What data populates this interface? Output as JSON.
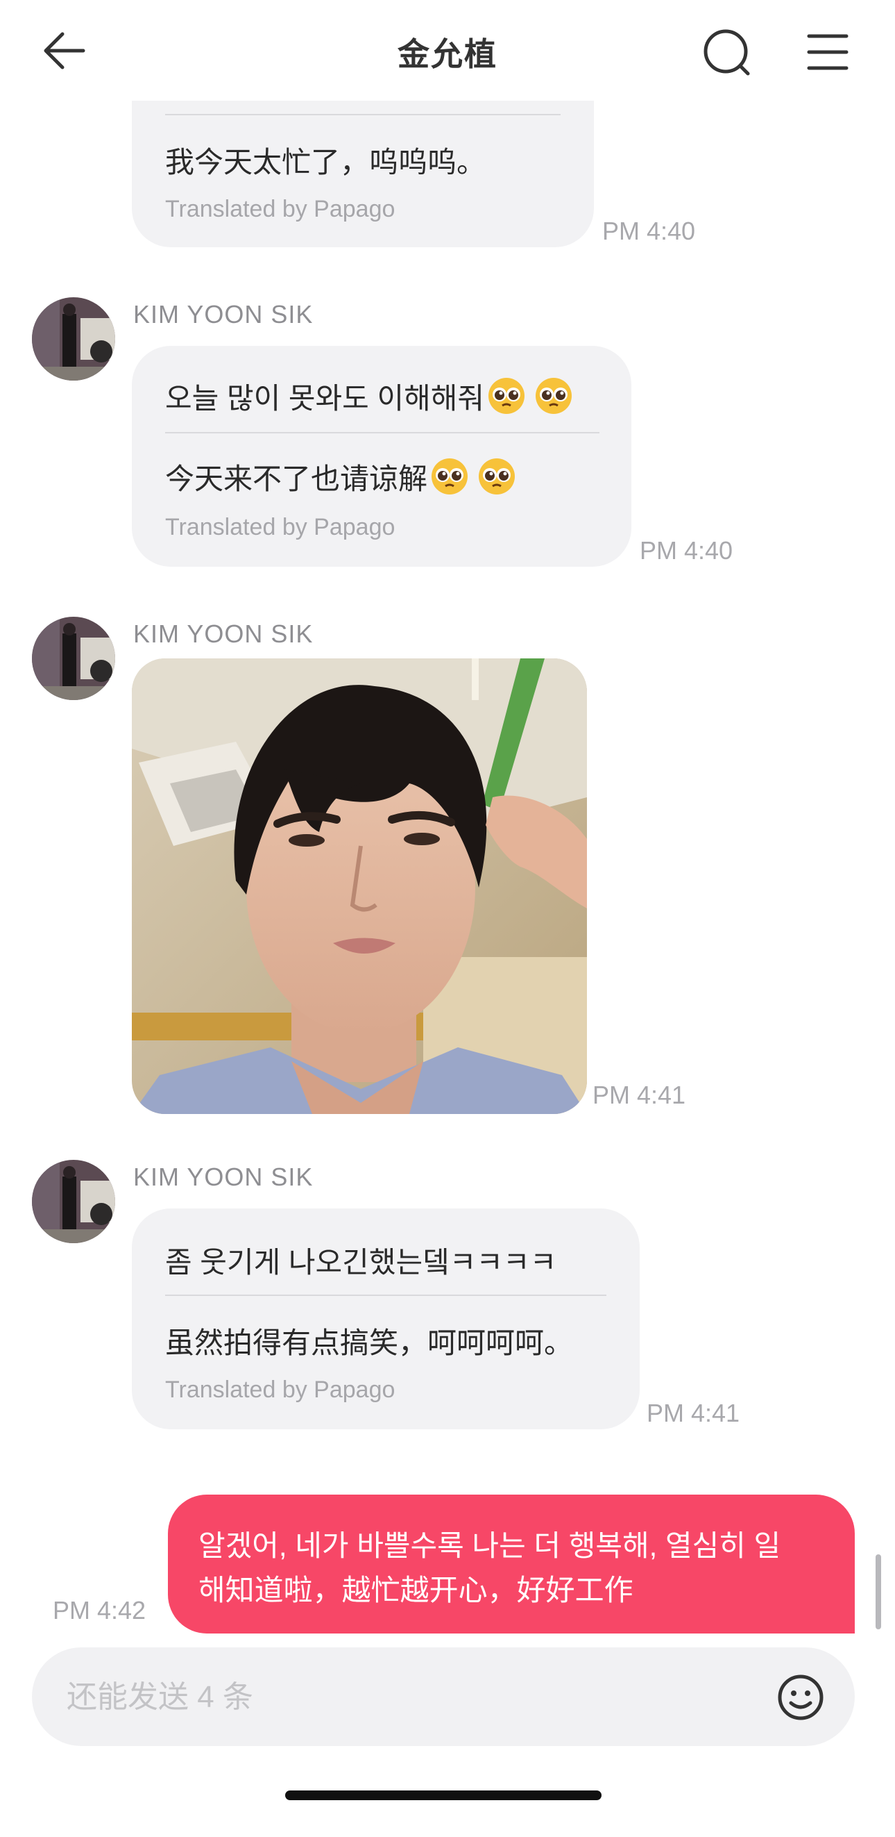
{
  "header": {
    "title": "金允植"
  },
  "messages": [
    {
      "translation": "我今天太忙了，呜呜呜。",
      "translated_by": "Translated by Papago",
      "time": "PM 4:40"
    },
    {
      "sender": "KIM YOON SIK",
      "original": "오늘 많이 못와도 이해해줘",
      "translation": "今天来不了也请谅解",
      "translated_by": "Translated by Papago",
      "time": "PM 4:40"
    },
    {
      "sender": "KIM YOON SIK",
      "type": "photo",
      "time": "PM 4:41"
    },
    {
      "sender": "KIM YOON SIK",
      "original": "좀 웃기게 나오긴했는뎈ㅋㅋㅋㅋ",
      "translation": "虽然拍得有点搞笑，呵呵呵呵。",
      "translated_by": "Translated by Papago",
      "time": "PM 4:41"
    },
    {
      "sender": "me",
      "line1": "알겠어, 네가 바쁠수록 나는 더 행복해, 열심히 일",
      "line2": "해知道啦，越忙越开心，好好工作",
      "time": "PM 4:42"
    }
  ],
  "input": {
    "placeholder": "还能发送 4 条"
  },
  "colors": {
    "my_bubble": "#f74767",
    "their_bubble": "#f2f2f4"
  }
}
